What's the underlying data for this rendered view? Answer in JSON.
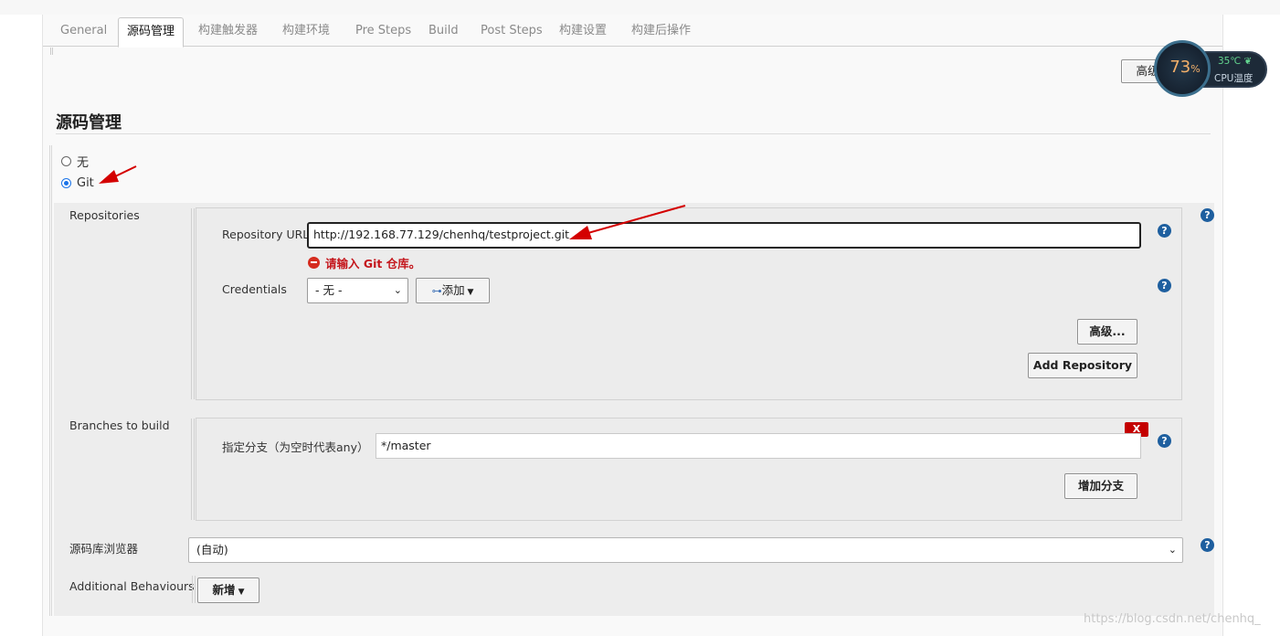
{
  "tabs": [
    "General",
    "源码管理",
    "构建触发器",
    "构建环境",
    "Pre Steps",
    "Build",
    "Post Steps",
    "构建设置",
    "构建后操作"
  ],
  "top_advanced_label": "高级",
  "section_title": "源码管理",
  "scm_options": {
    "none": "无",
    "git": "Git"
  },
  "repositories": {
    "label": "Repositories",
    "url_label": "Repository URL",
    "url_value": "http://192.168.77.129/chenhq/testproject.git",
    "error": "请输入 Git 仓库。",
    "credentials_label": "Credentials",
    "credentials_value": "- 无 -",
    "add_label": "添加",
    "advanced_label": "高级...",
    "add_repo_label": "Add Repository"
  },
  "branches": {
    "label": "Branches to build",
    "spec_label": "指定分支（为空时代表any）",
    "spec_value": "*/master",
    "delete_label": "X",
    "add_branch_label": "增加分支"
  },
  "browser": {
    "label": "源码库浏览器",
    "value": "(自动)"
  },
  "behaviours": {
    "label": "Additional Behaviours",
    "add_label": "新增"
  },
  "help_glyph": "?",
  "cpu_widget": {
    "percent": "73",
    "percent_sign": "%",
    "temp": "35℃",
    "label": "CPU温度"
  },
  "watermark": "https://blog.csdn.net/chenhq_",
  "colors": {
    "help": "#1e5f9f",
    "error": "#c4161c",
    "annotation_arrow": "#d40000",
    "radio_selected": "#1a73e8"
  }
}
